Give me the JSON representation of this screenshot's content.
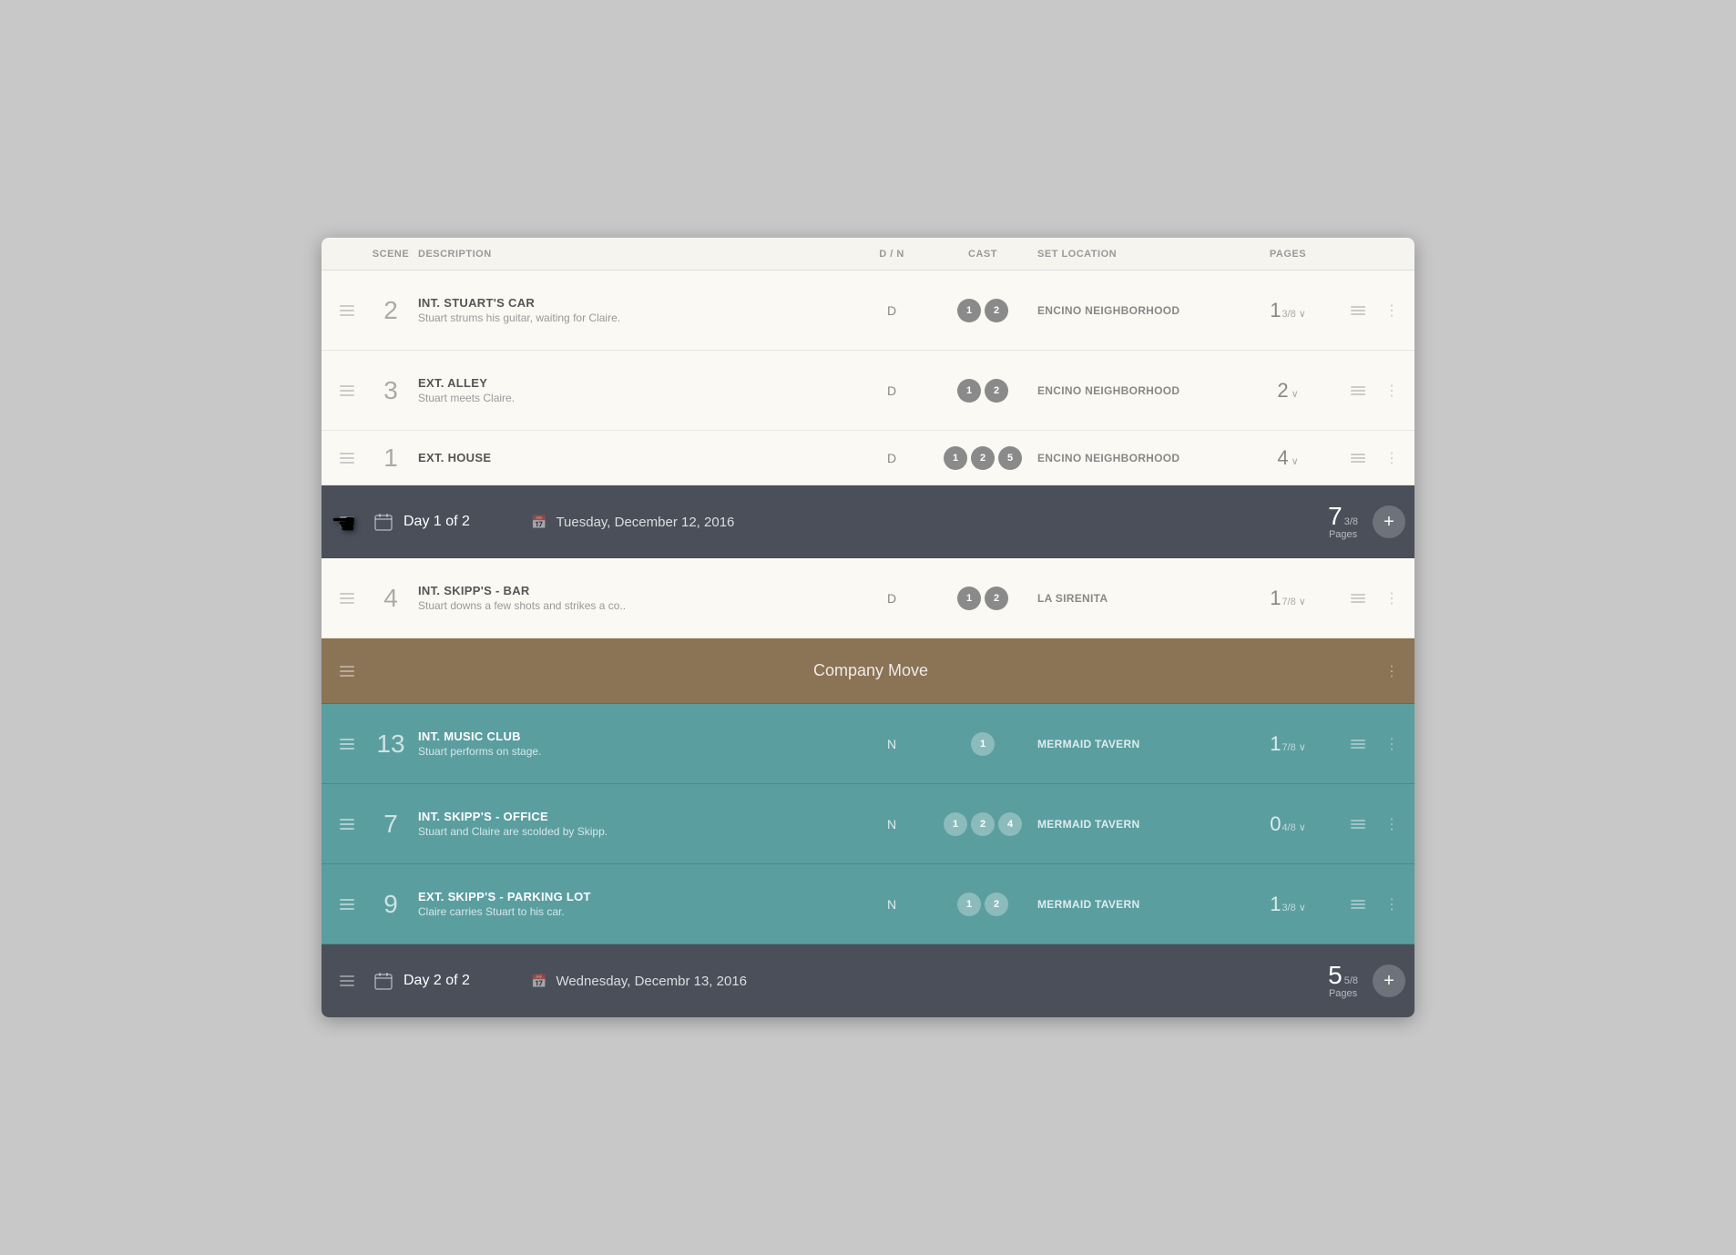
{
  "columns": {
    "scene": "SCENE",
    "description": "DESCRIPTION",
    "dm": "D / N",
    "cast": "CAST",
    "set_location": "SET LOCATION",
    "pages": "PAGES"
  },
  "scenes": [
    {
      "id": "scene-2",
      "num": "2",
      "title": "INT. STUART'S CAR",
      "description": "Stuart strums his guitar, waiting for Claire.",
      "dm": "D",
      "cast": [
        "1",
        "2"
      ],
      "location": "ENCINO NEIGHBORHOOD",
      "pages_main": "1",
      "pages_frac": "3/8",
      "day_group": 1,
      "teal": false
    },
    {
      "id": "scene-3",
      "num": "3",
      "title": "EXT. ALLEY",
      "description": "Stuart meets Claire.",
      "dm": "D",
      "cast": [
        "1",
        "2"
      ],
      "location": "ENCINO NEIGHBORHOOD",
      "pages_main": "2",
      "pages_frac": "",
      "day_group": 1,
      "teal": false
    },
    {
      "id": "scene-1",
      "num": "1",
      "title": "EXT. HOUSE",
      "description": "",
      "dm": "D",
      "cast": [
        "1",
        "2",
        "5"
      ],
      "location": "ENCINO NEIGHBORHOOD",
      "pages_main": "4",
      "pages_frac": "",
      "day_group": 1,
      "teal": false,
      "partial": true
    }
  ],
  "day1_banner": {
    "label": "Day 1 of 2",
    "date": "Tuesday, December 12, 2016",
    "pages_main": "7",
    "pages_frac": "3/8",
    "pages_label": "Pages"
  },
  "scene4": {
    "num": "4",
    "title": "INT. SKIPP'S - BAR",
    "description": "Stuart downs a few shots and strikes a co..",
    "dm": "D",
    "cast": [
      "1",
      "2"
    ],
    "location": "LA SIRENITA",
    "pages_main": "1",
    "pages_frac": "7/8"
  },
  "company_move": {
    "label": "Company Move"
  },
  "teal_scenes": [
    {
      "id": "scene-13",
      "num": "13",
      "title": "INT. MUSIC CLUB",
      "description": "Stuart performs on stage.",
      "dm": "N",
      "cast": [
        "1"
      ],
      "location": "MERMAID TAVERN",
      "pages_main": "1",
      "pages_frac": "7/8"
    },
    {
      "id": "scene-7",
      "num": "7",
      "title": "INT. SKIPP'S - OFFICE",
      "description": "Stuart and Claire are scolded by Skipp.",
      "dm": "N",
      "cast": [
        "1",
        "2",
        "4"
      ],
      "location": "MERMAID TAVERN",
      "pages_main": "0",
      "pages_frac": "4/8"
    },
    {
      "id": "scene-9",
      "num": "9",
      "title": "EXT. SKIPP'S - PARKING LOT",
      "description": "Claire carries Stuart to his car.",
      "dm": "N",
      "cast": [
        "1",
        "2"
      ],
      "location": "MERMAID TAVERN",
      "pages_main": "1",
      "pages_frac": "3/8"
    }
  ],
  "day2_banner": {
    "label": "Day 2 of 2",
    "date": "Wednesday, Decembr 13, 2016",
    "pages_main": "5",
    "pages_frac": "5/8",
    "pages_label": "Pages"
  },
  "colors": {
    "background": "#f5f4ef",
    "day_banner": "#4a4f5a",
    "teal": "#5b9ea0",
    "brown": "#8b7355",
    "header_text": "#999999"
  }
}
